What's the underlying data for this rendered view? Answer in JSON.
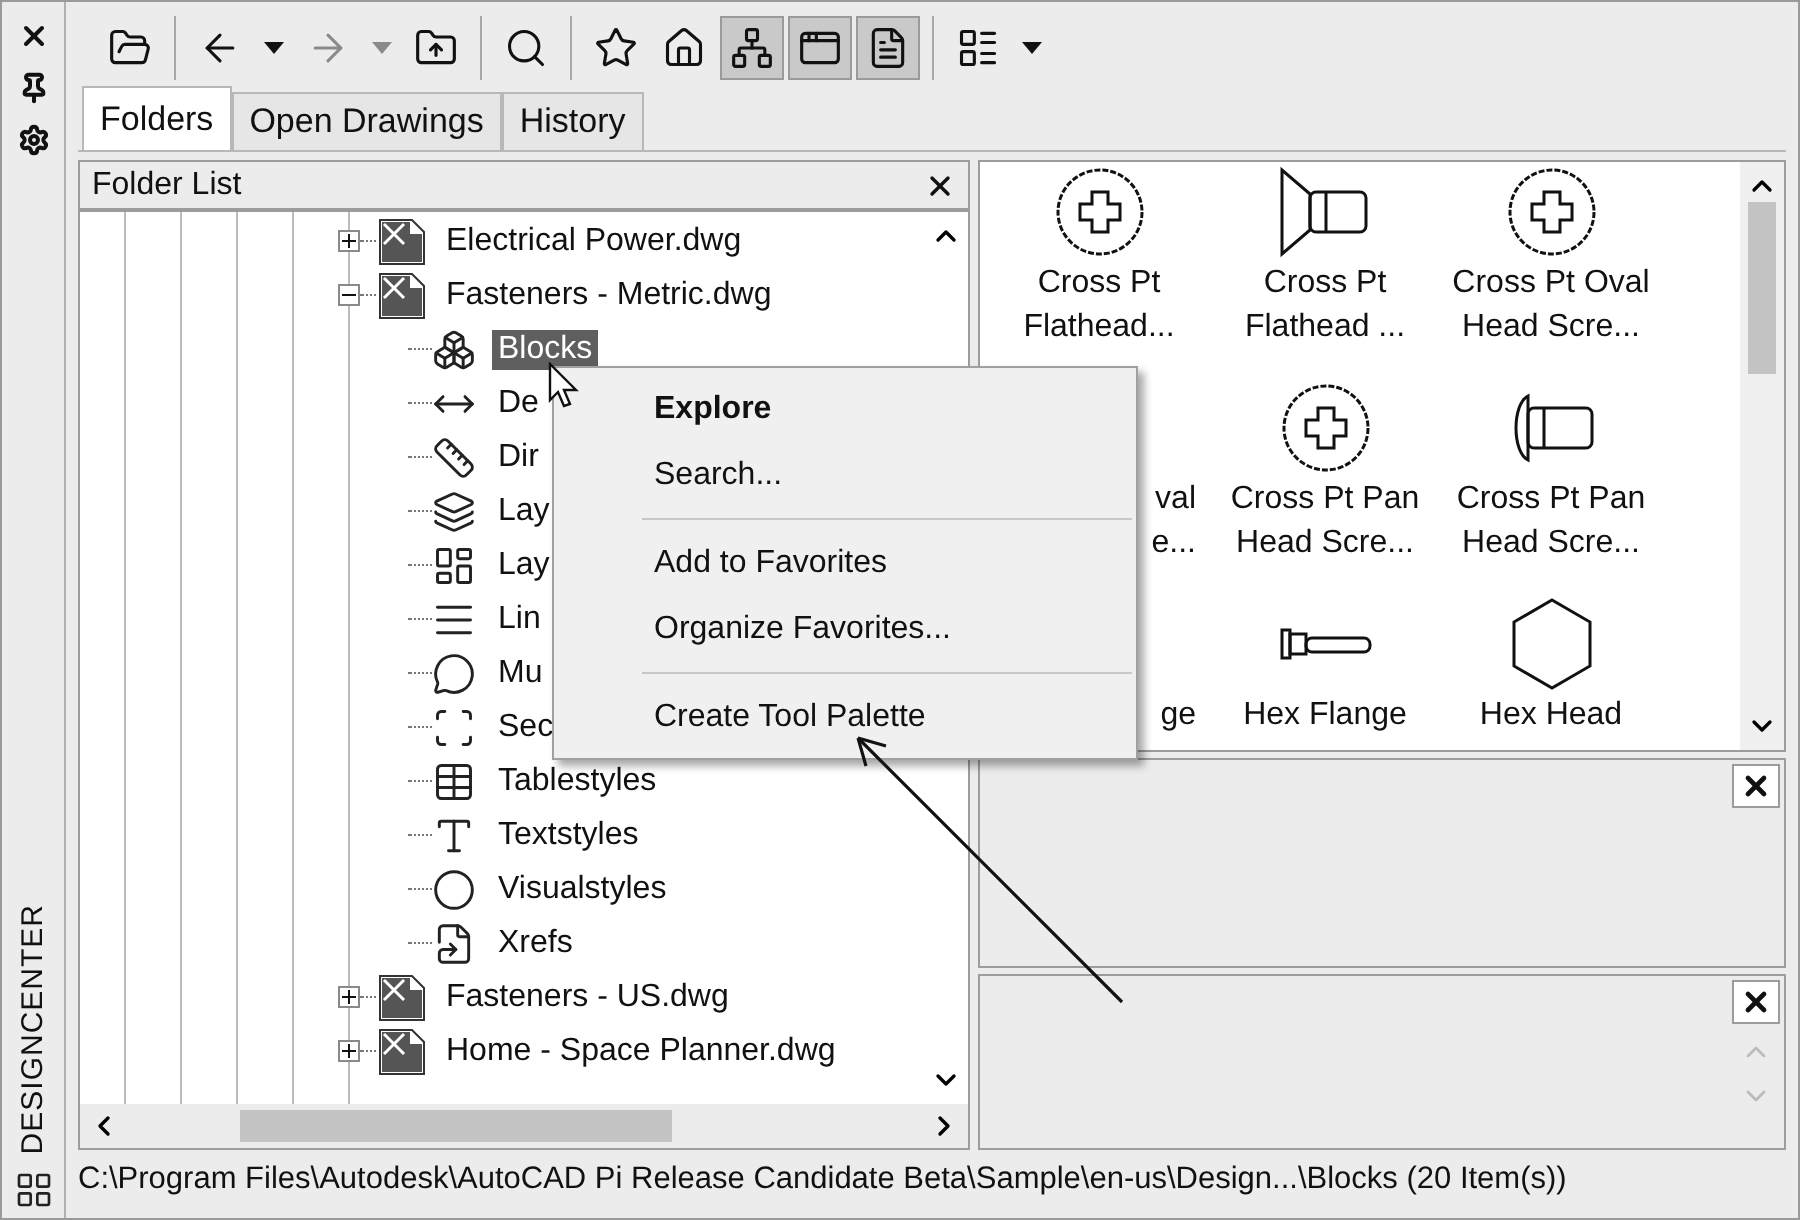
{
  "side_strip": {
    "title": "DESIGNCENTER",
    "buttons": [
      {
        "kind": "close"
      },
      {
        "kind": "autohide"
      },
      {
        "kind": "properties"
      }
    ]
  },
  "toolbar": {
    "groups": [
      {
        "buttons": [
          {
            "kind": "load",
            "pressed": false,
            "disabled": false
          }
        ]
      },
      {
        "buttons": [
          {
            "kind": "back",
            "pressed": false,
            "disabled": false
          },
          {
            "kind": "back-menu",
            "pressed": false,
            "disabled": false
          },
          {
            "kind": "forward",
            "pressed": false,
            "disabled": true
          },
          {
            "kind": "forward-menu",
            "pressed": false,
            "disabled": true
          },
          {
            "kind": "up",
            "pressed": false,
            "disabled": false
          }
        ]
      },
      {
        "buttons": [
          {
            "kind": "search",
            "pressed": false,
            "disabled": false
          }
        ]
      },
      {
        "buttons": [
          {
            "kind": "favorites",
            "pressed": false,
            "disabled": false
          },
          {
            "kind": "home",
            "pressed": false,
            "disabled": false
          },
          {
            "kind": "tree",
            "pressed": true,
            "disabled": false
          },
          {
            "kind": "preview",
            "pressed": true,
            "disabled": false
          },
          {
            "kind": "description",
            "pressed": true,
            "disabled": false
          }
        ]
      },
      {
        "buttons": [
          {
            "kind": "views",
            "pressed": false,
            "disabled": false
          },
          {
            "kind": "views-menu",
            "pressed": false,
            "disabled": false
          }
        ]
      }
    ]
  },
  "tabs": [
    {
      "label": "Folders",
      "selected": true
    },
    {
      "label": "Open Drawings",
      "selected": false
    },
    {
      "label": "History",
      "selected": false
    }
  ],
  "folder_list": {
    "title": "Folder List",
    "items": [
      {
        "label": "Electrical Power.dwg",
        "expanded": false,
        "selected": false
      },
      {
        "label": "Fasteners - Metric.dwg",
        "expanded": true,
        "selected": false,
        "children": [
          {
            "label": "Blocks",
            "kind": "blocks",
            "selected": true
          },
          {
            "label": "De",
            "kind": "dimstyles",
            "selected": false
          },
          {
            "label": "Dir",
            "kind": "dimension",
            "selected": false
          },
          {
            "label": "Lay",
            "kind": "layers",
            "selected": false
          },
          {
            "label": "Lay",
            "kind": "layouts",
            "selected": false
          },
          {
            "label": "Lin",
            "kind": "linetypes",
            "selected": false
          },
          {
            "label": "Mu",
            "kind": "multileader",
            "selected": false
          },
          {
            "label": "Sec",
            "kind": "section",
            "selected": false
          },
          {
            "label": "Tablestyles",
            "kind": "table",
            "selected": false
          },
          {
            "label": "Textstyles",
            "kind": "text",
            "selected": false
          },
          {
            "label": "Visualstyles",
            "kind": "visual",
            "selected": false
          },
          {
            "label": "Xrefs",
            "kind": "xref",
            "selected": false
          }
        ]
      },
      {
        "label": "Fasteners - US.dwg",
        "expanded": false,
        "selected": false
      },
      {
        "label": "Home - Space Planner.dwg",
        "expanded": false,
        "selected": false
      }
    ]
  },
  "palette": {
    "items": [
      {
        "kind": "cross-top",
        "covered": false,
        "label": [
          "Cross Pt",
          "Flathead..."
        ]
      },
      {
        "kind": "flat-side",
        "covered": false,
        "label": [
          "Cross Pt",
          "Flathead ..."
        ]
      },
      {
        "kind": "cross-top",
        "covered": false,
        "label": [
          "Cross Pt Oval",
          "Head Scre..."
        ]
      },
      {
        "covered": true,
        "label": [
          "val",
          "e..."
        ]
      },
      {
        "kind": "cross-top",
        "covered": false,
        "label": [
          "Cross Pt Pan",
          "Head Scre..."
        ]
      },
      {
        "kind": "pan-side",
        "covered": false,
        "label": [
          "Cross Pt Pan",
          "Head Scre..."
        ]
      },
      {
        "covered": true,
        "label": [
          "ge"
        ]
      },
      {
        "kind": "flange-side",
        "covered": false,
        "label": [
          "Hex Flange"
        ]
      },
      {
        "kind": "hex-top",
        "covered": false,
        "label": [
          "Hex Head"
        ]
      }
    ]
  },
  "context_menu": {
    "items": [
      {
        "kind": "item",
        "label": "Explore",
        "default": true
      },
      {
        "kind": "item",
        "label": "Search...",
        "default": false
      },
      {
        "kind": "separator"
      },
      {
        "kind": "item",
        "label": "Add to Favorites",
        "default": false
      },
      {
        "kind": "item",
        "label": "Organize Favorites...",
        "default": false
      },
      {
        "kind": "separator"
      },
      {
        "kind": "item",
        "label": "Create Tool Palette",
        "default": false
      }
    ]
  },
  "status_bar": "C:\\Program Files\\Autodesk\\AutoCAD Pi Release Candidate Beta\\Sample\\en-us\\Design...\\Blocks (20 Item(s))"
}
